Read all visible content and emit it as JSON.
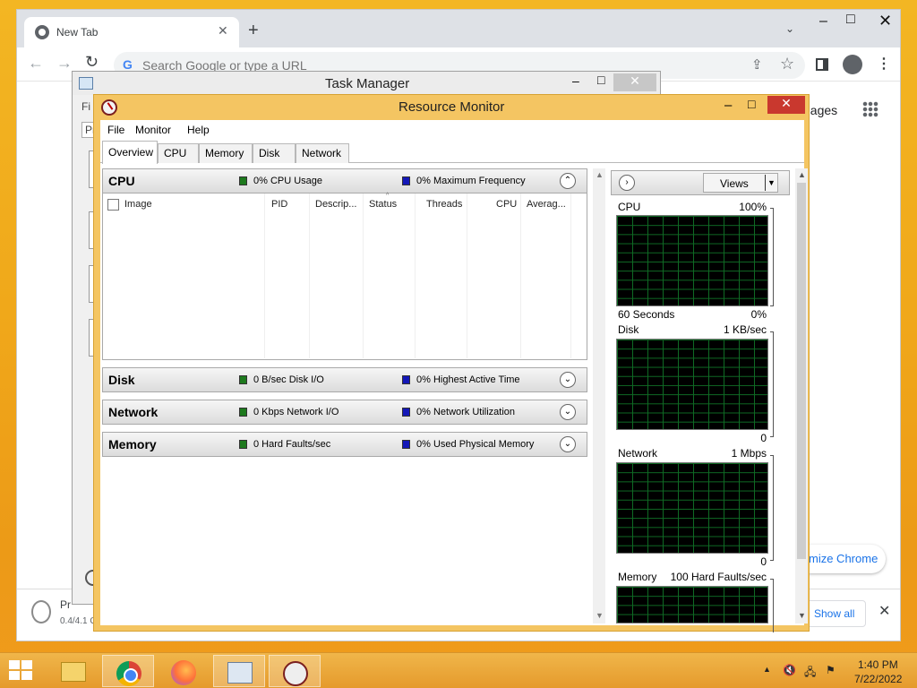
{
  "browser": {
    "tab_title": "New Tab",
    "tab_close": "✕",
    "new_tab": "+",
    "tab_list": "⌄",
    "window_min": "–",
    "window_max": "□",
    "window_close": "✕",
    "back": "←",
    "forward": "→",
    "reload": "↻",
    "google_g": "G",
    "omnibox_placeholder": "Search Google or type a URL",
    "share": "⇪",
    "bookmark": "☆",
    "menu": "⋮",
    "images_link": "nages",
    "customize_label": "mize Chrome",
    "download": {
      "name": "Pr",
      "size": "0.4/4.1 C",
      "show_all": "Show all",
      "close": "✕"
    }
  },
  "task_manager": {
    "title": "Task Manager",
    "min": "–",
    "max": "□",
    "close": "✕",
    "menu_file": "Fi",
    "tab_partial": "Pr"
  },
  "resource_monitor": {
    "title": "Resource Monitor",
    "min": "–",
    "max": "□",
    "close": "✕",
    "menu": [
      "File",
      "Monitor",
      "Help"
    ],
    "tabs": [
      "Overview",
      "CPU",
      "Memory",
      "Disk",
      "Network"
    ],
    "active_tab": "Overview",
    "sections": {
      "cpu": {
        "title": "CPU",
        "stat1": "0% CPU Usage",
        "stat2": "0% Maximum Frequency",
        "toggle": "⌃",
        "columns": [
          "Image",
          "PID",
          "Descrip...",
          "Status",
          "Threads",
          "CPU",
          "Averag..."
        ]
      },
      "disk": {
        "title": "Disk",
        "stat1": "0 B/sec Disk I/O",
        "stat2": "0% Highest Active Time",
        "toggle": "⌄"
      },
      "network": {
        "title": "Network",
        "stat1": "0 Kbps Network I/O",
        "stat2": "0% Network Utilization",
        "toggle": "⌄"
      },
      "memory": {
        "title": "Memory",
        "stat1": "0 Hard Faults/sec",
        "stat2": "0% Used Physical Memory",
        "toggle": "⌄"
      }
    },
    "right_pane": {
      "expand": "›",
      "views_label": "Views",
      "views_dropdown": "▼",
      "graphs": [
        {
          "name": "CPU",
          "max": "100%",
          "footer_left": "60 Seconds",
          "footer_right": "0%"
        },
        {
          "name": "Disk",
          "max": "1 KB/sec",
          "footer_left": "",
          "footer_right": "0"
        },
        {
          "name": "Network",
          "max": "1 Mbps",
          "footer_left": "",
          "footer_right": "0"
        },
        {
          "name": "Memory",
          "max": "100 Hard Faults/sec",
          "footer_left": "",
          "footer_right": ""
        }
      ]
    },
    "scroll_up": "▲",
    "scroll_down": "▼",
    "sort_arrow": "^"
  },
  "taskbar": {
    "clock_time": "1:40 PM",
    "clock_date": "7/22/2022",
    "tray_chevron": "▲",
    "tray_volume": "🔇",
    "tray_network": "🖧",
    "tray_flag": "⚑"
  },
  "colors": {
    "accent_chrome_blue": "#1a73e8",
    "resmon_frame": "#f4c562",
    "resmon_close": "#c9382e",
    "legend_green": "#1e7a1e",
    "legend_blue": "#1418b8",
    "graph_grid": "#0f6a24"
  }
}
